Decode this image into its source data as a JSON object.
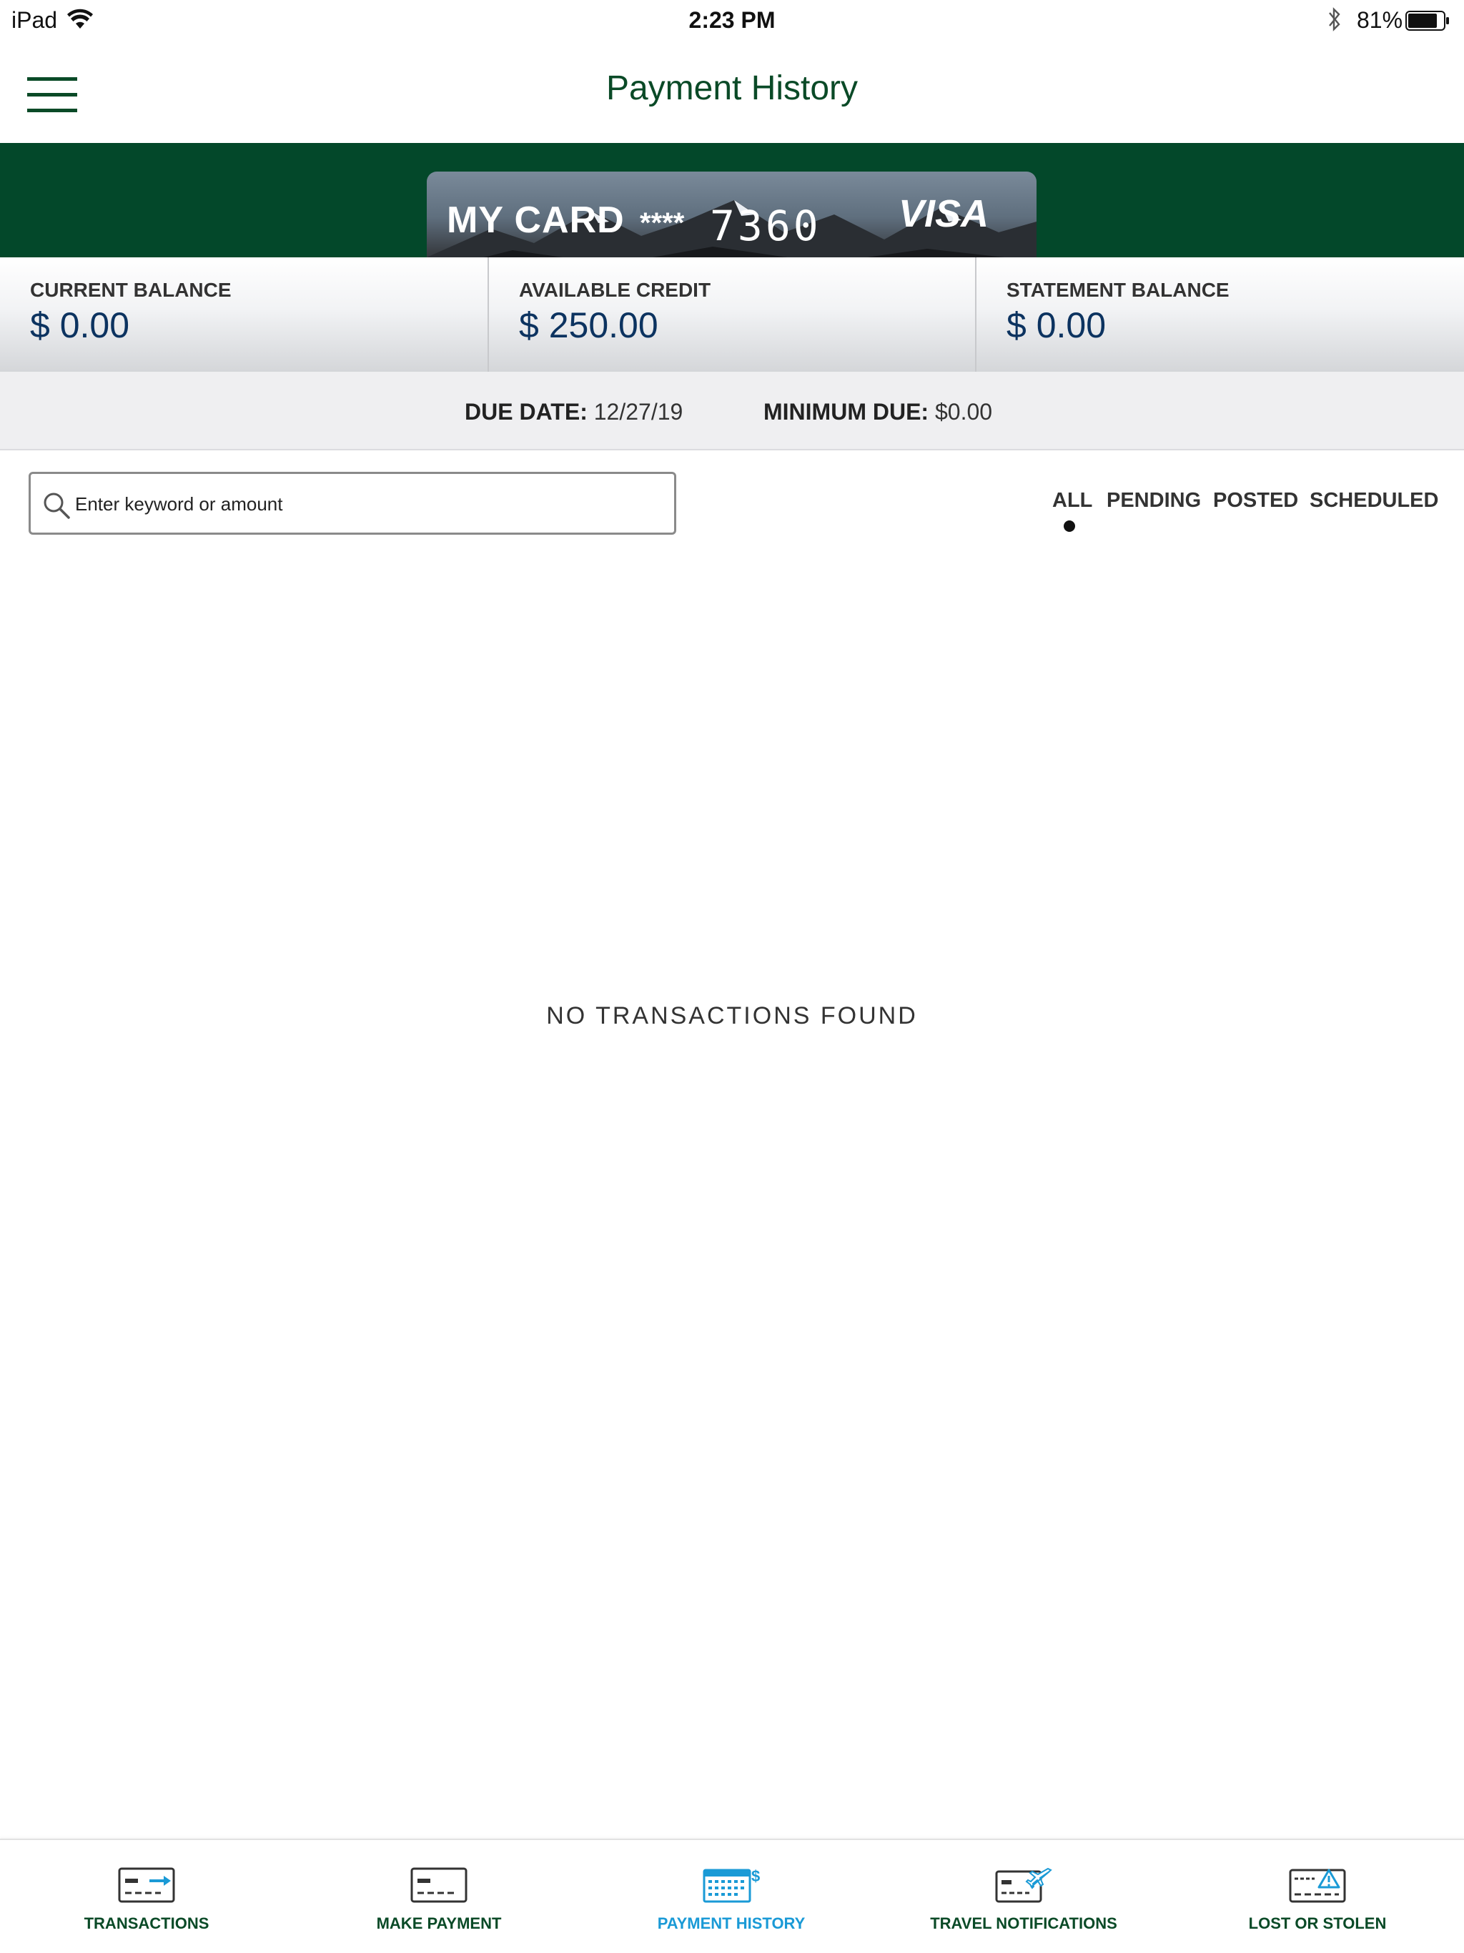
{
  "status_bar": {
    "device": "iPad",
    "time": "2:23 PM",
    "battery_percent": "81%"
  },
  "header": {
    "title": "Payment History"
  },
  "card": {
    "name": "MY CARD",
    "masked": "****",
    "last_digits": "7360",
    "brand": "VISA"
  },
  "balances": [
    {
      "label": "CURRENT BALANCE",
      "value": "$ 0.00"
    },
    {
      "label": "AVAILABLE CREDIT",
      "value": "$ 250.00"
    },
    {
      "label": "STATEMENT BALANCE",
      "value": "$ 0.00"
    }
  ],
  "due": {
    "date_label": "DUE DATE:",
    "date_value": "12/27/19",
    "minimum_label": "MINIMUM DUE:",
    "minimum_value": "$0.00"
  },
  "search": {
    "placeholder": "Enter keyword or amount",
    "value": ""
  },
  "filters": {
    "items": [
      "ALL",
      "PENDING",
      "POSTED",
      "SCHEDULED"
    ],
    "selected": "ALL"
  },
  "empty_message": "NO TRANSACTIONS FOUND",
  "tab_bar": {
    "items": [
      {
        "label": "TRANSACTIONS",
        "icon": "transactions-card-icon"
      },
      {
        "label": "MAKE PAYMENT",
        "icon": "make-payment-card-icon"
      },
      {
        "label": "PAYMENT HISTORY",
        "icon": "payment-history-calendar-icon"
      },
      {
        "label": "TRAVEL NOTIFICATIONS",
        "icon": "travel-card-plane-icon"
      },
      {
        "label": "LOST OR STOLEN",
        "icon": "lost-card-warning-icon"
      }
    ],
    "active": "PAYMENT HISTORY"
  },
  "colors": {
    "brand_green": "#03482a",
    "title_green": "#0a4a27",
    "balance_blue": "#0c3360",
    "active_tab_blue": "#1a9ad6"
  }
}
